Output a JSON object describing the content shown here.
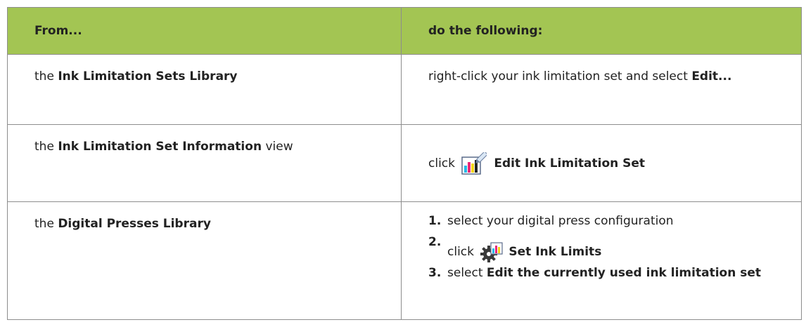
{
  "table": {
    "headers": [
      "From...",
      "do the following:"
    ],
    "rows": [
      {
        "from_pre": "the ",
        "from_bold": "Ink Limitation Sets Library",
        "from_post": "",
        "action_pre": "right-click your ink limitation set and select ",
        "action_bold": "Edit..."
      },
      {
        "from_pre": "the ",
        "from_bold": "Ink Limitation Set Information",
        "from_post": " view",
        "action_pre": "click ",
        "action_icon": "edit-ink-limitation-set-icon",
        "action_bold": "Edit Ink Limitation Set"
      },
      {
        "from_pre": "the ",
        "from_bold": "Digital Presses Library",
        "from_post": "",
        "steps": [
          {
            "num": "1.",
            "pre": "select your digital press configuration",
            "bold": ""
          },
          {
            "num": "2.",
            "pre": "click ",
            "icon": "set-ink-limits-icon",
            "bold": "Set Ink Limits"
          },
          {
            "num": "3.",
            "pre": "select ",
            "bold": "Edit the currently used ink limitation set"
          }
        ]
      }
    ]
  },
  "colors": {
    "header_bg": "#a3c553",
    "border": "#8d8d8d",
    "text": "#222222"
  }
}
